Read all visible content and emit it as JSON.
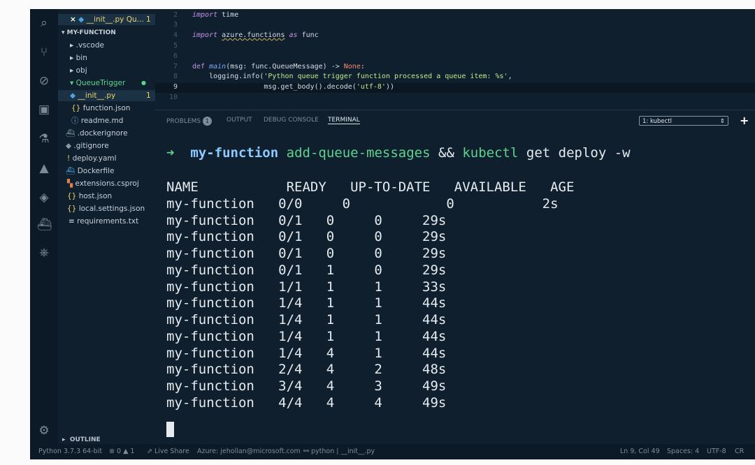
{
  "explorer": {
    "open_tab": {
      "name": "__init__.py",
      "folder": "Qu...",
      "count": "1"
    },
    "root": "MY-FUNCTION",
    "items": [
      {
        "label": ".vscode",
        "icon": "chevron-right-icon"
      },
      {
        "label": "bin",
        "icon": "chevron-right-icon"
      },
      {
        "label": "obj",
        "icon": "chevron-right-icon"
      },
      {
        "label": "QueueTrigger",
        "icon": "chevron-down-icon"
      },
      {
        "label": "__init__.py",
        "icon": "python-icon",
        "badge": "1"
      },
      {
        "label": "function.json",
        "icon": "json-icon"
      },
      {
        "label": "readme.md",
        "icon": "info-icon"
      },
      {
        "label": ".dockerignore",
        "icon": "docker-icon"
      },
      {
        "label": ".gitignore",
        "icon": "git-icon"
      },
      {
        "label": "deploy.yaml",
        "icon": "yaml-icon"
      },
      {
        "label": "Dockerfile",
        "icon": "docker-icon"
      },
      {
        "label": "extensions.csproj",
        "icon": "csproj-icon"
      },
      {
        "label": "host.json",
        "icon": "json-icon"
      },
      {
        "label": "local.settings.json",
        "icon": "json-icon"
      },
      {
        "label": "requirements.txt",
        "icon": "text-file-icon"
      }
    ],
    "outline": "OUTLINE"
  },
  "editor": {
    "lines": [
      {
        "n": "2",
        "code": "import time"
      },
      {
        "n": "3",
        "code": ""
      },
      {
        "n": "4",
        "code": "import azure.functions as func"
      },
      {
        "n": "5",
        "code": ""
      },
      {
        "n": "6",
        "code": ""
      },
      {
        "n": "7",
        "code": "def main(msg: func.QueueMessage) -> None:"
      },
      {
        "n": "8",
        "code": "    logging.info('Python queue trigger function processed a queue item: %s',"
      },
      {
        "n": "9",
        "code": "                 msg.get_body().decode('utf-8'))"
      },
      {
        "n": "10",
        "code": ""
      }
    ]
  },
  "panel": {
    "tabs": {
      "problems": "PROBLEMS",
      "problems_count": "1",
      "output": "OUTPUT",
      "debug": "DEBUG CONSOLE",
      "terminal": "TERMINAL"
    },
    "terminal_select": "1: kubectl",
    "add_terminal": "+"
  },
  "terminal": {
    "prompt": {
      "arrow": "➜",
      "dir": "my-function",
      "branch": "add-queue-messages",
      "cmd_sep": "&&",
      "kubectl": "kubectl",
      "args": "get deploy -w"
    },
    "header": "NAME           READY   UP-TO-DATE   AVAILABLE   AGE",
    "rows": [
      "my-function   0/0     0            0           2s",
      "my-function   0/1   0     0     29s",
      "my-function   0/1   0     0     29s",
      "my-function   0/1   0     0     29s",
      "my-function   0/1   1     0     29s",
      "my-function   1/1   1     1     33s",
      "my-function   1/4   1     1     44s",
      "my-function   1/4   1     1     44s",
      "my-function   1/4   1     1     44s",
      "my-function   1/4   4     1     44s",
      "my-function   2/4   4     2     48s",
      "my-function   3/4   4     3     49s",
      "my-function   4/4   4     4     49s"
    ]
  },
  "status": {
    "python": "Python 3.7.3 64-bit",
    "errors": "0",
    "warnings": "1",
    "live_share": "Live Share",
    "azure": "Azure: jehollan@microsoft.com",
    "interpreter": "python | __init__.py",
    "position": "Ln 9, Col 49",
    "spaces": "Spaces: 4",
    "encoding": "UTF-8",
    "eol": "CR"
  }
}
